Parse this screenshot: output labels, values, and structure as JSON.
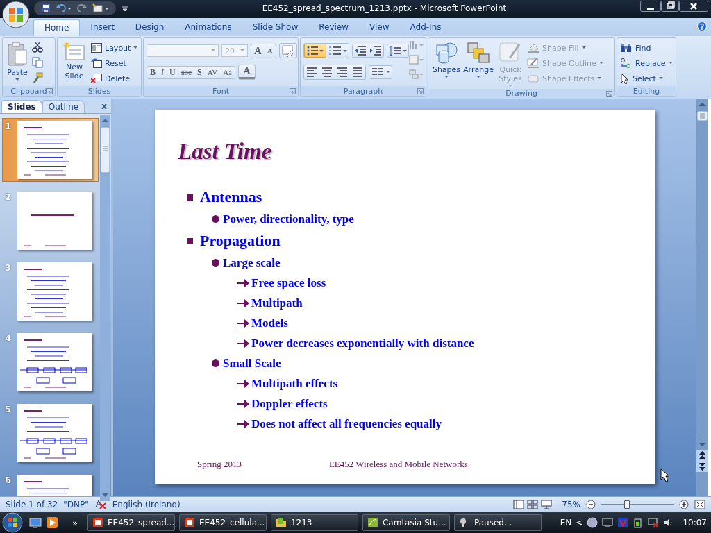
{
  "window": {
    "title": "EE452_spread_spectrum_1213.pptx - Microsoft PowerPoint"
  },
  "tabs": [
    {
      "label": "Home",
      "selected": true
    },
    {
      "label": "Insert",
      "selected": false
    },
    {
      "label": "Design",
      "selected": false
    },
    {
      "label": "Animations",
      "selected": false
    },
    {
      "label": "Slide Show",
      "selected": false
    },
    {
      "label": "Review",
      "selected": false
    },
    {
      "label": "View",
      "selected": false
    },
    {
      "label": "Add-Ins",
      "selected": false
    }
  ],
  "ribbon": [
    {
      "kind": "clipboard",
      "label": "Clipboard",
      "large": [
        {
          "label": "Paste"
        }
      ]
    },
    {
      "kind": "slides",
      "label": "Slides",
      "large": [
        {
          "label": "New Slide"
        }
      ],
      "small": [
        {
          "label": "Layout",
          "dropdown": true
        },
        {
          "label": "Reset",
          "dropdown": false
        },
        {
          "label": "Delete",
          "dropdown": false
        }
      ]
    },
    {
      "kind": "font",
      "label": "Font",
      "font_size": "20",
      "grow": "A",
      "shrink": "A",
      "format_buttons": [
        "B",
        "I",
        "U",
        "abc",
        "S",
        "AV",
        "Aa"
      ],
      "font_color": "A"
    },
    {
      "kind": "paragraph",
      "label": "Paragraph",
      "bullets_selected": true
    },
    {
      "kind": "drawing",
      "label": "Drawing",
      "large": [
        {
          "label": "Shapes",
          "disabled": false
        },
        {
          "label": "Arrange",
          "disabled": false
        },
        {
          "label": "Quick Styles",
          "disabled": true
        }
      ],
      "small": [
        {
          "label": "Shape Fill",
          "dropdown": true,
          "disabled": true
        },
        {
          "label": "Shape Outline",
          "dropdown": true,
          "disabled": true
        },
        {
          "label": "Shape Effects",
          "dropdown": true,
          "disabled": true
        }
      ]
    },
    {
      "kind": "editing",
      "label": "Editing",
      "small": [
        {
          "label": "Find",
          "dropdown": false,
          "disabled": false
        },
        {
          "label": "Replace",
          "dropdown": true,
          "disabled": false
        },
        {
          "label": "Select",
          "dropdown": true,
          "disabled": false
        }
      ]
    }
  ],
  "pane_tabs": [
    {
      "label": "Slides",
      "selected": true
    },
    {
      "label": "Outline",
      "selected": false
    }
  ],
  "pane_close": "x",
  "thumbnails": [
    {
      "number": "1",
      "selected": true,
      "kind": "bullets"
    },
    {
      "number": "2",
      "selected": false,
      "kind": "title"
    },
    {
      "number": "3",
      "selected": false,
      "kind": "bullets"
    },
    {
      "number": "4",
      "selected": false,
      "kind": "diagram"
    },
    {
      "number": "5",
      "selected": false,
      "kind": "diagram"
    },
    {
      "number": "6",
      "selected": false,
      "kind": "bullets"
    }
  ],
  "slide": {
    "title": "Last Time",
    "bullets": [
      {
        "text": "Antennas",
        "children": [
          {
            "text": "Power, directionality, type"
          }
        ]
      },
      {
        "text": "Propagation",
        "children": [
          {
            "text": "Large scale",
            "children": [
              {
                "text": "Free space loss"
              },
              {
                "text": "Multipath"
              },
              {
                "text": "Models"
              },
              {
                "text": "Power decreases exponentially with distance"
              }
            ]
          },
          {
            "text": "Small Scale",
            "children": [
              {
                "text": "Multipath effects"
              },
              {
                "text": "Doppler effects"
              },
              {
                "text": "Does not affect all frequencies equally"
              }
            ]
          }
        ]
      }
    ],
    "footer_left": "Spring 2013",
    "footer_center": "EE452 Wireless and Mobile Networks"
  },
  "status_bar": {
    "slide": "Slide 1 of 32",
    "theme": "\"DNP\"",
    "language": "English (Ireland)",
    "zoom": "75%",
    "zoom_slider": {
      "level": 0.36
    }
  },
  "taskbar": {
    "tasks": [
      {
        "label": "EE452_spread...",
        "kind": "ppt"
      },
      {
        "label": "EE452_cellula...",
        "kind": "ppt"
      },
      {
        "label": "1213",
        "kind": "folder"
      },
      {
        "label": "Camtasia Stu...",
        "kind": "camtasia"
      },
      {
        "label": "Paused...",
        "kind": "recorder"
      }
    ],
    "more": "»",
    "language": "EN",
    "tray_expand": "<",
    "clock": "10:07"
  }
}
